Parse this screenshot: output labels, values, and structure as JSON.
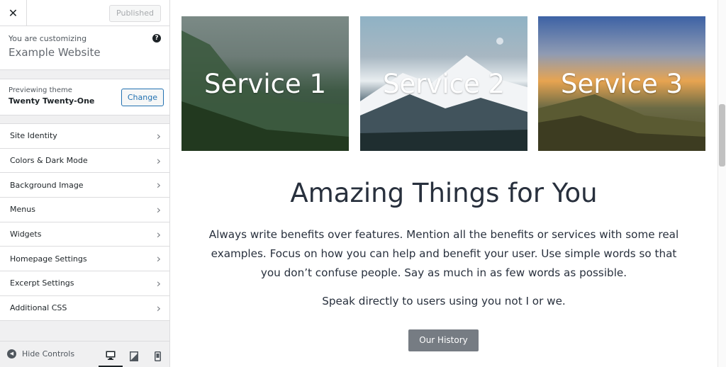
{
  "topbar": {
    "close_label": "✕",
    "published_label": "Published"
  },
  "customizing": {
    "label": "You are customizing",
    "site_name": "Example Website"
  },
  "theme": {
    "label": "Previewing theme",
    "name": "Twenty Twenty-One",
    "change_label": "Change"
  },
  "menu": {
    "items": [
      {
        "label": "Site Identity"
      },
      {
        "label": "Colors & Dark Mode"
      },
      {
        "label": "Background Image"
      },
      {
        "label": "Menus"
      },
      {
        "label": "Widgets"
      },
      {
        "label": "Homepage Settings"
      },
      {
        "label": "Excerpt Settings"
      },
      {
        "label": "Additional CSS"
      }
    ]
  },
  "footer": {
    "hide_label": "Hide Controls",
    "devices": [
      "desktop-icon",
      "tablet-icon",
      "mobile-icon"
    ],
    "active_device": "desktop"
  },
  "preview": {
    "services": [
      "Service 1",
      "Service 2",
      "Service 3"
    ],
    "heading": "Amazing Things for You",
    "body": "Always write benefits over features. Mention all the benefits or services with some real examples. Focus on how you can help and benefit your user. Use simple words so that you don’t confuse people. Say as much in as few words as possible.",
    "speak": "Speak directly to users using you not I or we.",
    "button_label": "Our History"
  },
  "colors": {
    "accent": "#2271b1",
    "text": "#28303d",
    "button": "#767c83"
  }
}
